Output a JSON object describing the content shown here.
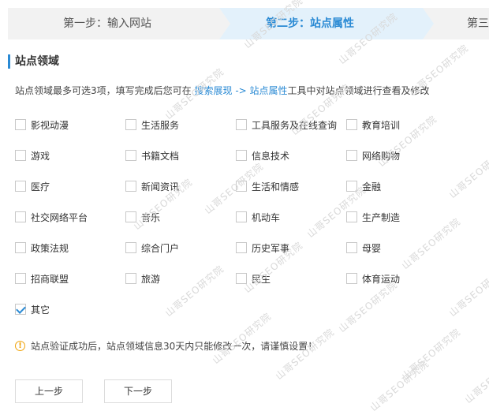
{
  "steps": {
    "step1": "第一步：输入网站",
    "step2": "第二步：站点属性",
    "step3": "第三"
  },
  "section": {
    "title": "站点领域",
    "hint_prefix": "站点领域最多可选3项，填写完成后您可在",
    "hint_link1": "搜索展现",
    "hint_arrow": "->",
    "hint_link2": "站点属性",
    "hint_suffix": "工具中对站点领域进行查看及修改"
  },
  "categories": [
    {
      "label": "影视动漫",
      "checked": false
    },
    {
      "label": "生活服务",
      "checked": false
    },
    {
      "label": "工具服务及在线查询",
      "checked": false
    },
    {
      "label": "教育培训",
      "checked": false
    },
    {
      "label": "游戏",
      "checked": false
    },
    {
      "label": "书籍文档",
      "checked": false
    },
    {
      "label": "信息技术",
      "checked": false
    },
    {
      "label": "网络购物",
      "checked": false
    },
    {
      "label": "医疗",
      "checked": false
    },
    {
      "label": "新闻资讯",
      "checked": false
    },
    {
      "label": "生活和情感",
      "checked": false
    },
    {
      "label": "金融",
      "checked": false
    },
    {
      "label": "社交网络平台",
      "checked": false
    },
    {
      "label": "音乐",
      "checked": false
    },
    {
      "label": "机动车",
      "checked": false
    },
    {
      "label": "生产制造",
      "checked": false
    },
    {
      "label": "政策法规",
      "checked": false
    },
    {
      "label": "综合门户",
      "checked": false
    },
    {
      "label": "历史军事",
      "checked": false
    },
    {
      "label": "母婴",
      "checked": false
    },
    {
      "label": "招商联盟",
      "checked": false
    },
    {
      "label": "旅游",
      "checked": false
    },
    {
      "label": "民生",
      "checked": false
    },
    {
      "label": "体育运动",
      "checked": false
    },
    {
      "label": "其它",
      "checked": true
    }
  ],
  "notice": {
    "icon": "warning-icon",
    "text": "站点验证成功后，站点领域信息30天内只能修改一次，请谨慎设置！"
  },
  "buttons": {
    "prev": "上一步",
    "next": "下一步"
  },
  "watermark": "山哥SEO研究院",
  "colors": {
    "accent": "#2a8ad4",
    "active_step_bg": "#e3f1fb",
    "warning": "#f0a30a"
  }
}
